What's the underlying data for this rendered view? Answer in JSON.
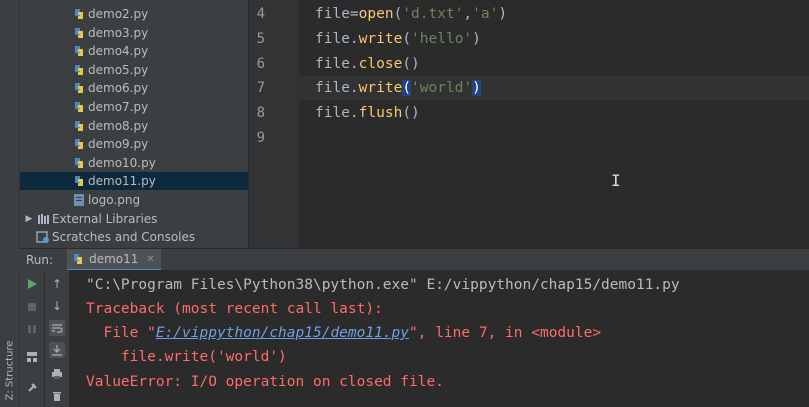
{
  "left_strip": {
    "structure_tab": "Z: Structure"
  },
  "project_tree": {
    "files": [
      {
        "name": "demo2.py",
        "selected": false
      },
      {
        "name": "demo3.py",
        "selected": false
      },
      {
        "name": "demo4.py",
        "selected": false
      },
      {
        "name": "demo5.py",
        "selected": false
      },
      {
        "name": "demo6.py",
        "selected": false
      },
      {
        "name": "demo7.py",
        "selected": false
      },
      {
        "name": "demo8.py",
        "selected": false
      },
      {
        "name": "demo9.py",
        "selected": false
      },
      {
        "name": "demo10.py",
        "selected": false
      },
      {
        "name": "demo11.py",
        "selected": true
      },
      {
        "name": "logo.png",
        "selected": false
      }
    ],
    "external_libraries": "External Libraries",
    "scratches": "Scratches and Consoles"
  },
  "editor": {
    "lines": [
      {
        "num": "4",
        "code": "file=open('d.txt','a')"
      },
      {
        "num": "5",
        "code": "file.write('hello')"
      },
      {
        "num": "6",
        "code": "file.close()"
      },
      {
        "num": "7",
        "code": "file.write('world')"
      },
      {
        "num": "8",
        "code": "file.flush()"
      },
      {
        "num": "9",
        "code": ""
      }
    ]
  },
  "run_panel": {
    "label": "Run:",
    "tab_name": "demo11",
    "console": {
      "command": "\"C:\\Program Files\\Python38\\python.exe\" E:/vippython/chap15/demo11.py",
      "traceback_header": "Traceback (most recent call last):",
      "file_prefix": "  File \"",
      "file_link": "E:/vippython/chap15/demo11.py",
      "file_suffix": "\", line 7, in <module>",
      "source_line": "    file.write('world')",
      "error": "ValueError: I/O operation on closed file."
    }
  },
  "colors": {
    "background": "#2b2b2b",
    "panel": "#3c3f41",
    "selection": "#0d293e",
    "error_text": "#ff6b68",
    "link": "#6e9fe0",
    "method": "#ffc66d",
    "string": "#6a8759"
  }
}
